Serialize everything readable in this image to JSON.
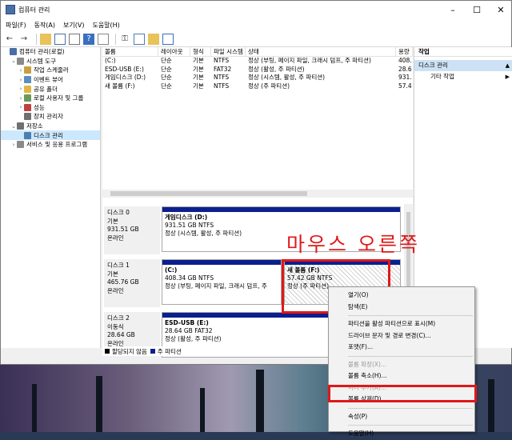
{
  "window": {
    "title": "컴퓨터 관리",
    "controls": {
      "minimize": "–",
      "maximize": "☐",
      "close": "✕"
    }
  },
  "menubar": [
    "파일(F)",
    "동작(A)",
    "보기(V)",
    "도움말(H)"
  ],
  "tree": [
    {
      "label": "컴퓨터 관리(로컬)",
      "indent": 0,
      "arrow": "",
      "icon_color": "#4a6fa5"
    },
    {
      "label": "시스템 도구",
      "indent": 1,
      "arrow": "⌄",
      "icon_color": "#8a8a8a"
    },
    {
      "label": "작업 스케줄러",
      "indent": 2,
      "arrow": "›",
      "icon_color": "#c8a040"
    },
    {
      "label": "이벤트 뷰어",
      "indent": 2,
      "arrow": "›",
      "icon_color": "#5a8fc0"
    },
    {
      "label": "공유 폴더",
      "indent": 2,
      "arrow": "›",
      "icon_color": "#e2b544"
    },
    {
      "label": "로컬 사용자 및 그룹",
      "indent": 2,
      "arrow": "›",
      "icon_color": "#6a9a5a"
    },
    {
      "label": "성능",
      "indent": 2,
      "arrow": "›",
      "icon_color": "#c04040"
    },
    {
      "label": "장치 관리자",
      "indent": 2,
      "arrow": "",
      "icon_color": "#707070"
    },
    {
      "label": "저장소",
      "indent": 1,
      "arrow": "⌄",
      "icon_color": "#707070"
    },
    {
      "label": "디스크 관리",
      "indent": 2,
      "arrow": "",
      "icon_color": "#4a7fb0",
      "selected": true
    },
    {
      "label": "서비스 및 응용 프로그램",
      "indent": 1,
      "arrow": "›",
      "icon_color": "#8a8a8a"
    }
  ],
  "volume_table": {
    "headers": [
      "볼륨",
      "레이아웃",
      "형식",
      "파일 시스템",
      "상태",
      "용량"
    ],
    "rows": [
      [
        "(C:)",
        "단순",
        "기본",
        "NTFS",
        "정상 (부팅, 페이지 파일, 크래시 덤프, 주 파티션)",
        "408."
      ],
      [
        "ESD-USB (E:)",
        "단순",
        "기본",
        "FAT32",
        "정상 (활성, 주 파티션)",
        "28.6"
      ],
      [
        "게임디스크 (D:)",
        "단순",
        "기본",
        "NTFS",
        "정상 (시스템, 활성, 주 파티션)",
        "931."
      ],
      [
        "새 볼륨 (F:)",
        "단순",
        "기본",
        "NTFS",
        "정상 (주 파티션)",
        "57.4"
      ]
    ]
  },
  "disks": [
    {
      "label": [
        "디스크 0",
        "기본",
        "931.51 GB",
        "온라인"
      ],
      "partitions": [
        {
          "lines": [
            "게임디스크 (D:)",
            "931.51 GB NTFS",
            "정상 (시스템, 활성, 주 파티션)"
          ]
        }
      ]
    },
    {
      "label": [
        "디스크 1",
        "기본",
        "465.76 GB",
        "온라인"
      ],
      "partitions": [
        {
          "lines": [
            "(C:)",
            "408.34 GB NTFS",
            "정상 (부팅, 페이지 파일, 크래시 덤프, 주"
          ]
        },
        {
          "lines": [
            "새 볼륨 (F:)",
            "57.42 GB NTFS",
            "정상 (주 파티션)"
          ]
        }
      ]
    },
    {
      "label": [
        "디스크 2",
        "이동식",
        "28.64 GB",
        "온라인"
      ],
      "partitions": [
        {
          "lines": [
            "ESD-USB (E:)",
            "28.64 GB FAT32",
            "정상 (활성, 주 파티션)"
          ]
        }
      ]
    }
  ],
  "legend": [
    {
      "label": "할당되지 않음",
      "color": "#000000"
    },
    {
      "label": "주 파티션",
      "color": "#0b1f8f"
    }
  ],
  "actions": {
    "header": "작업",
    "selected": "디스크 관리",
    "items": [
      "기타 작업"
    ]
  },
  "annotation": "마우스 오른쪽",
  "context_menu": [
    {
      "label": "열기(O)"
    },
    {
      "label": "탐색(E)"
    },
    {
      "sep": true
    },
    {
      "label": "파티션을 활성 파티션으로 표시(M)"
    },
    {
      "label": "드라이브 문자 및 경로 변경(C)..."
    },
    {
      "label": "포맷(F)..."
    },
    {
      "sep": true
    },
    {
      "label": "볼륨 확장(X)...",
      "disabled": true
    },
    {
      "label": "볼륨 축소(H)..."
    },
    {
      "label": "미러 추가(A)...",
      "disabled": true
    },
    {
      "label": "볼륨 삭제(D)..."
    },
    {
      "sep": true
    },
    {
      "label": "속성(P)"
    },
    {
      "sep": true
    },
    {
      "label": "도움말(H)"
    }
  ],
  "colors": {
    "highlight": "#e01818",
    "partition_bar": "#0b1f8f",
    "selection": "#cce8ff"
  }
}
